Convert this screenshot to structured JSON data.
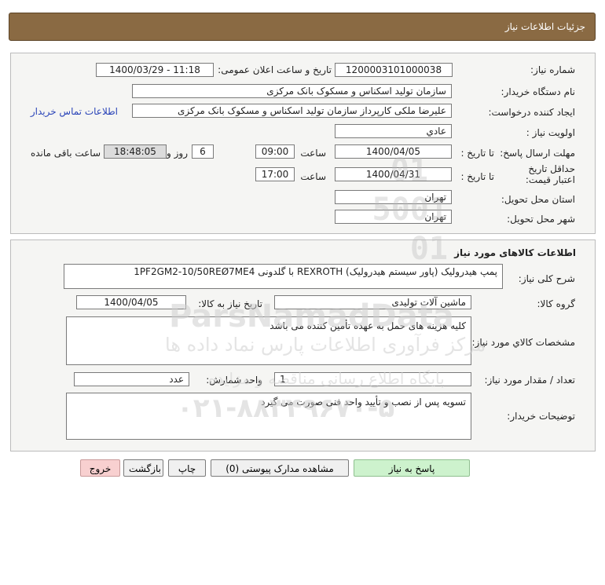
{
  "header": {
    "title": "جزئیات اطلاعات نیاز"
  },
  "need": {
    "number_label": "شماره نیاز:",
    "number": "1200003101000038",
    "announce_label": "تاریخ و ساعت اعلان عمومی:",
    "announce_value": "1400/03/29 - 11:18",
    "buyer_org_label": "نام دستگاه خریدار:",
    "buyer_org": "سازمان تولید اسکناس و مسکوک بانک مرکزی",
    "requester_label": "ایجاد کننده درخواست:",
    "requester": "علیرضا ملکی کارپرداز سازمان تولید اسکناس و مسکوک بانک مرکزی",
    "contact_link": "اطلاعات تماس خریدار",
    "priority_label": "اولویت نیاز :",
    "priority": "عادي",
    "reply_deadline_label": "مهلت ارسال پاسخ:",
    "until_date_label": "تا تاریخ :",
    "reply_date": "1400/04/05",
    "time_label": "ساعت",
    "reply_time": "09:00",
    "days_value": "6",
    "days_label": "روز و",
    "remaining_time": "18:48:05",
    "remaining_label": "ساعت باقی مانده",
    "price_validity_label": "حداقل تاریخ اعتبار قیمت:",
    "price_until_label": "تا تاریخ :",
    "price_date": "1400/04/31",
    "price_time_label": "ساعت",
    "price_time": "17:00",
    "province_label": "استان محل تحویل:",
    "province": "تهران",
    "city_label": "شهر محل تحویل:",
    "city": "تهران"
  },
  "goods": {
    "section_title": "اطلاعات کالاهای مورد نیاز",
    "summary_label": "شرح کلی نیاز:",
    "summary": "پمپ هیدرولیک (پاور سیستم هیدرولیک) REXROTH با گلدونی 1PF2GM2-10/50REØ7ME4",
    "group_label": "گروه کالا:",
    "group": "ماشین آلات تولیدی",
    "need_date_label": "تاریخ نیاز به کالا:",
    "need_date": "1400/04/05",
    "spec_label": "مشخصات کالاي مورد نیاز:",
    "spec": "کلیه هزینه های حمل به عهده تأمین کننده می باشد",
    "qty_label": "تعداد / مقدار مورد نیاز:",
    "qty": "1",
    "unit_label": "واحد شمارش:",
    "unit": "عدد",
    "notes_label": "توضیحات خریدار:",
    "notes": "تسویه پس از نصب و تأیید واحد فنی صورت می گیرد"
  },
  "buttons": {
    "reply": "پاسخ به نیاز",
    "attachments": "مشاهده مدارک پیوستی (0)",
    "print": "چاپ",
    "back": "بازگشت",
    "exit": "خروج"
  },
  "watermark": {
    "logo_text": "ParsNamadData",
    "center_line": "مرکز فرآوری اطلاعات پارس نماد داده ها",
    "portal_line": "پایگاه اطلاع رسانی مناقصه و مزایده",
    "phone": "۰۲۱-۸۸۳۴۹۶۷۰-۵"
  },
  "colors": {
    "header_bg": "#8a6a43",
    "reply_btn": "#cdf2cd",
    "exit_btn": "#f8d0d0",
    "link": "#2a44b8"
  }
}
